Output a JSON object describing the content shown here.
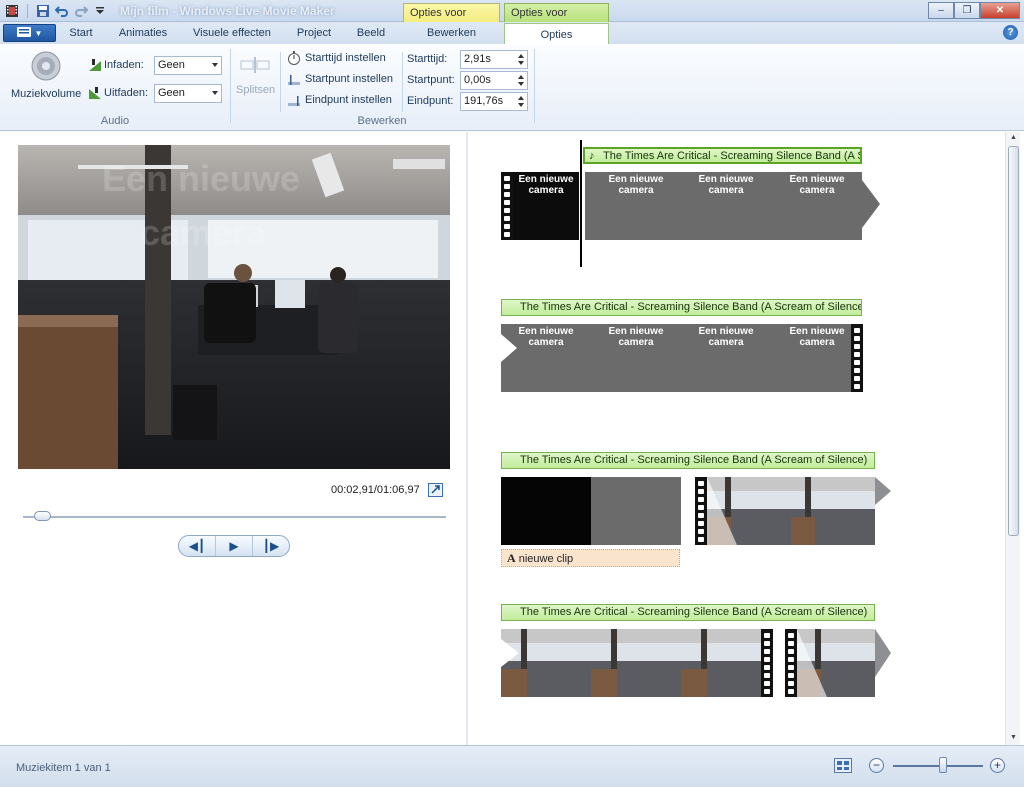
{
  "window": {
    "title": "Mijn film - Windows Live Movie Maker",
    "context_tabs": [
      "Opties voor video",
      "Opties voor muziek"
    ],
    "controls": [
      "minimize",
      "maximize",
      "close"
    ]
  },
  "tabs": {
    "app_menu": "app-menu",
    "items": [
      "Start",
      "Animaties",
      "Visuele effecten",
      "Project",
      "Beeld",
      "Bewerken",
      "Opties"
    ],
    "active": "Opties"
  },
  "ribbon": {
    "audio": {
      "group_label": "Audio",
      "volume_label": "Muziekvolume",
      "fade_in_label": "Infaden:",
      "fade_in_value": "Geen",
      "fade_out_label": "Uitfaden:",
      "fade_out_value": "Geen"
    },
    "edit": {
      "group_label": "Bewerken",
      "split_label": "Splitsen",
      "set_start_time": "Starttijd instellen",
      "set_start_point": "Startpunt instellen",
      "set_end_point": "Eindpunt instellen",
      "start_time_label": "Starttijd:",
      "start_time_value": "2,91s",
      "start_point_label": "Startpunt:",
      "start_point_value": "0,00s",
      "end_point_label": "Eindpunt:",
      "end_point_value": "191,76s"
    }
  },
  "preview": {
    "overlay_title_line1": "Een nieuwe",
    "overlay_title_line2": "camera",
    "timecode": "00:02,91/01:06,97",
    "seek_fraction": 0.044
  },
  "storyboard": {
    "music_title_full": "The Times Are Critical - Screaming Silence Band (A Scream of Silence)",
    "music_title_truncated": "The Times Are Critical - Screaming Silence Band (A Scr...",
    "clip_text_line1": "Een nieuwe",
    "clip_text_line2": "camera",
    "caption_text": "nieuwe clip",
    "caption_icon_letter": "A"
  },
  "status": {
    "text": "Muziekitem 1 van 1",
    "zoom_fraction": 0.56
  },
  "colors": {
    "music_label_bg": "#c2ec9b",
    "ctx_video": "#f3ec7c",
    "ctx_music": "#b6e07a",
    "caption_bg": "#fbe4ce"
  }
}
